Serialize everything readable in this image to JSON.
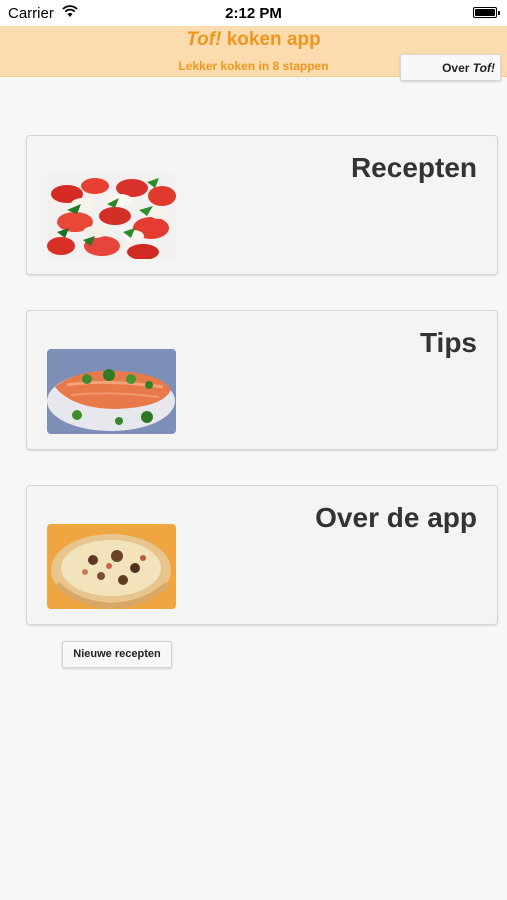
{
  "status_bar": {
    "carrier": "Carrier",
    "time": "2:12 PM"
  },
  "header": {
    "title_brand": "Tof!",
    "title_rest": " koken app",
    "subtitle": "Lekker koken in 8 stappen",
    "about_button_prefix": "Over ",
    "about_button_brand": "Tof!",
    "background_color": "#fcdcae",
    "accent_color": "#f0961c"
  },
  "cards": [
    {
      "title": "Recepten",
      "image": "caprese-salad-photo"
    },
    {
      "title": "Tips",
      "image": "salmon-dish-photo"
    },
    {
      "title": "Over de app",
      "image": "quiche-photo"
    }
  ],
  "new_recipes_button": "Nieuwe recepten"
}
